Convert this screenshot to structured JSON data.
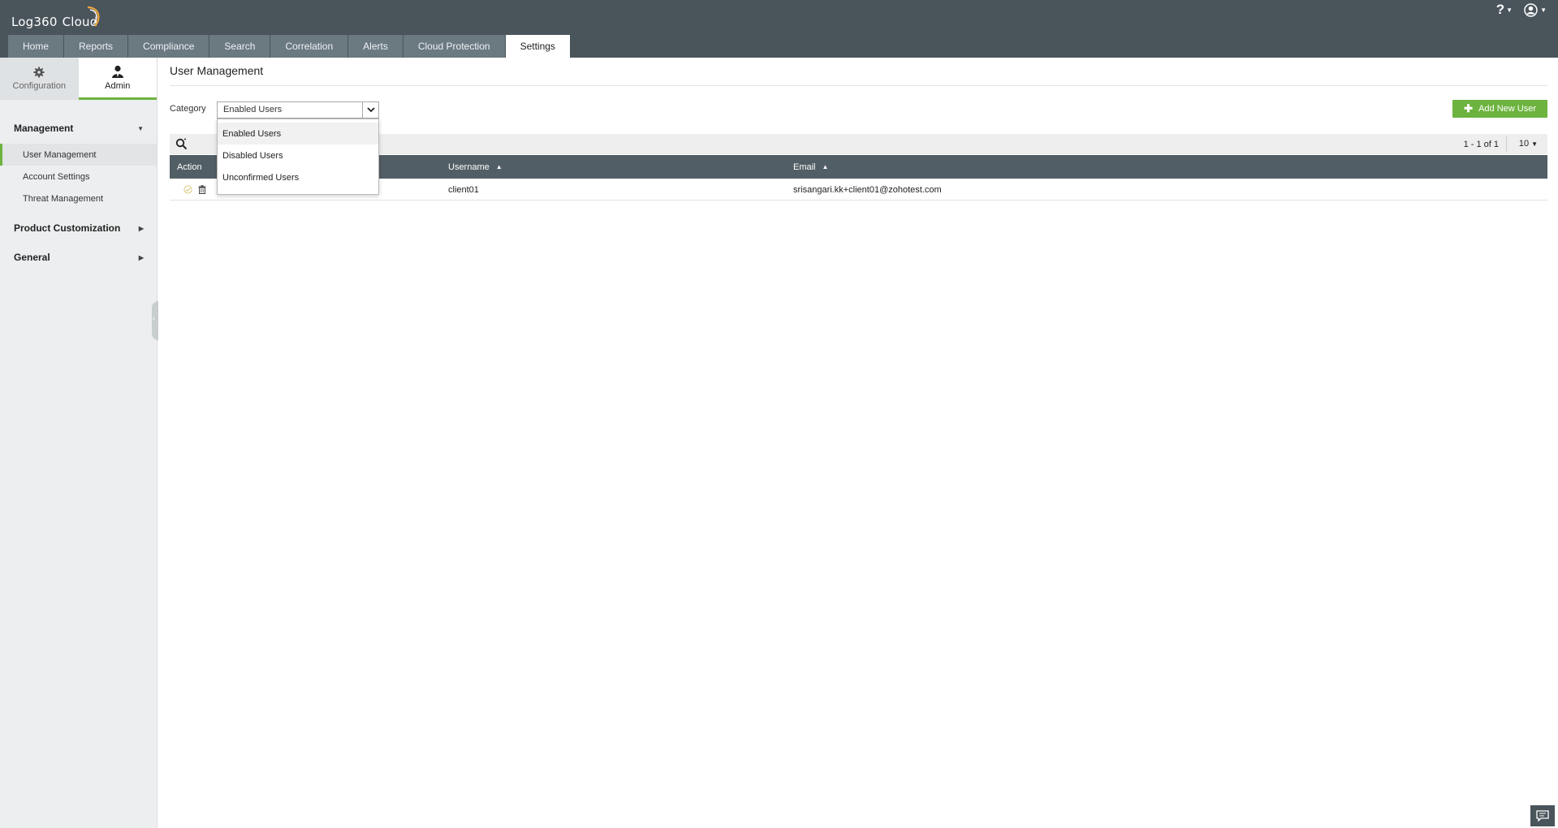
{
  "header": {
    "app_name": "Log360",
    "app_suffix": "Cloud",
    "help_label": "?"
  },
  "nav": {
    "tabs": [
      {
        "label": "Home"
      },
      {
        "label": "Reports"
      },
      {
        "label": "Compliance"
      },
      {
        "label": "Search"
      },
      {
        "label": "Correlation"
      },
      {
        "label": "Alerts"
      },
      {
        "label": "Cloud Protection"
      },
      {
        "label": "Settings"
      }
    ],
    "active": "Settings"
  },
  "sidebar": {
    "tabs": [
      {
        "label": "Configuration",
        "icon": "gear-icon"
      },
      {
        "label": "Admin",
        "icon": "user-icon"
      }
    ],
    "management": {
      "title": "Management",
      "items": [
        {
          "label": "User Management"
        },
        {
          "label": "Account Settings"
        },
        {
          "label": "Threat Management"
        }
      ]
    },
    "product_customization": {
      "title": "Product Customization"
    },
    "general": {
      "title": "General"
    }
  },
  "main": {
    "title": "User Management",
    "category": {
      "label": "Category",
      "selected": "Enabled Users",
      "options": [
        "Enabled Users",
        "Disabled Users",
        "Unconfirmed Users"
      ]
    },
    "add_button": "Add New User",
    "pager": {
      "range": "1 - 1 of 1",
      "per_page": "10"
    },
    "table": {
      "columns": [
        "Action",
        "Username",
        "Email"
      ],
      "rows": [
        {
          "username": "client01",
          "email": "srisangari.kk+client01@zohotest.com"
        }
      ]
    }
  },
  "colors": {
    "header_bg": "#4a545b",
    "accent_green": "#6db33f",
    "table_head_bg": "#525e65"
  }
}
